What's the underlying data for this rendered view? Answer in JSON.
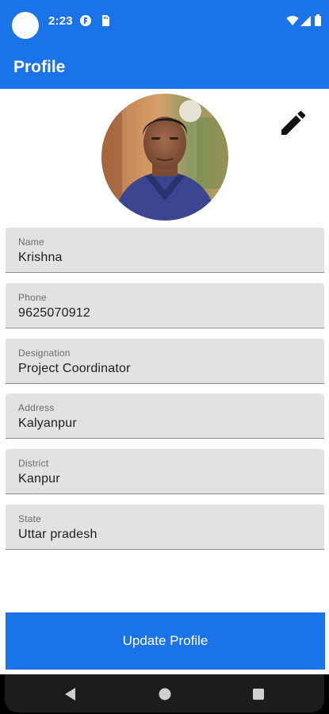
{
  "status_bar": {
    "time": "2:23",
    "icons_left": [
      "circle-app-icon",
      "sd-card-icon"
    ],
    "icons_right": [
      "wifi-icon",
      "signal-icon",
      "battery-icon"
    ]
  },
  "app_bar": {
    "title": "Profile"
  },
  "profile": {
    "avatar": "profile-photo",
    "edit_icon": "pencil-icon"
  },
  "fields": [
    {
      "label": "Name",
      "value": "Krishna"
    },
    {
      "label": "Phone",
      "value": "9625070912"
    },
    {
      "label": "Designation",
      "value": "Project Coordinator"
    },
    {
      "label": "Address",
      "value": "Kalyanpur"
    },
    {
      "label": "District",
      "value": "Kanpur"
    },
    {
      "label": "State",
      "value": "Uttar pradesh"
    }
  ],
  "actions": {
    "update_label": "Update Profile"
  },
  "nav_bar": {
    "buttons": [
      "back-icon",
      "home-icon",
      "recents-icon"
    ]
  },
  "colors": {
    "primary": "#1a73e8",
    "field_bg": "#e2e2e2",
    "nav_bg": "#1c1c1c"
  }
}
